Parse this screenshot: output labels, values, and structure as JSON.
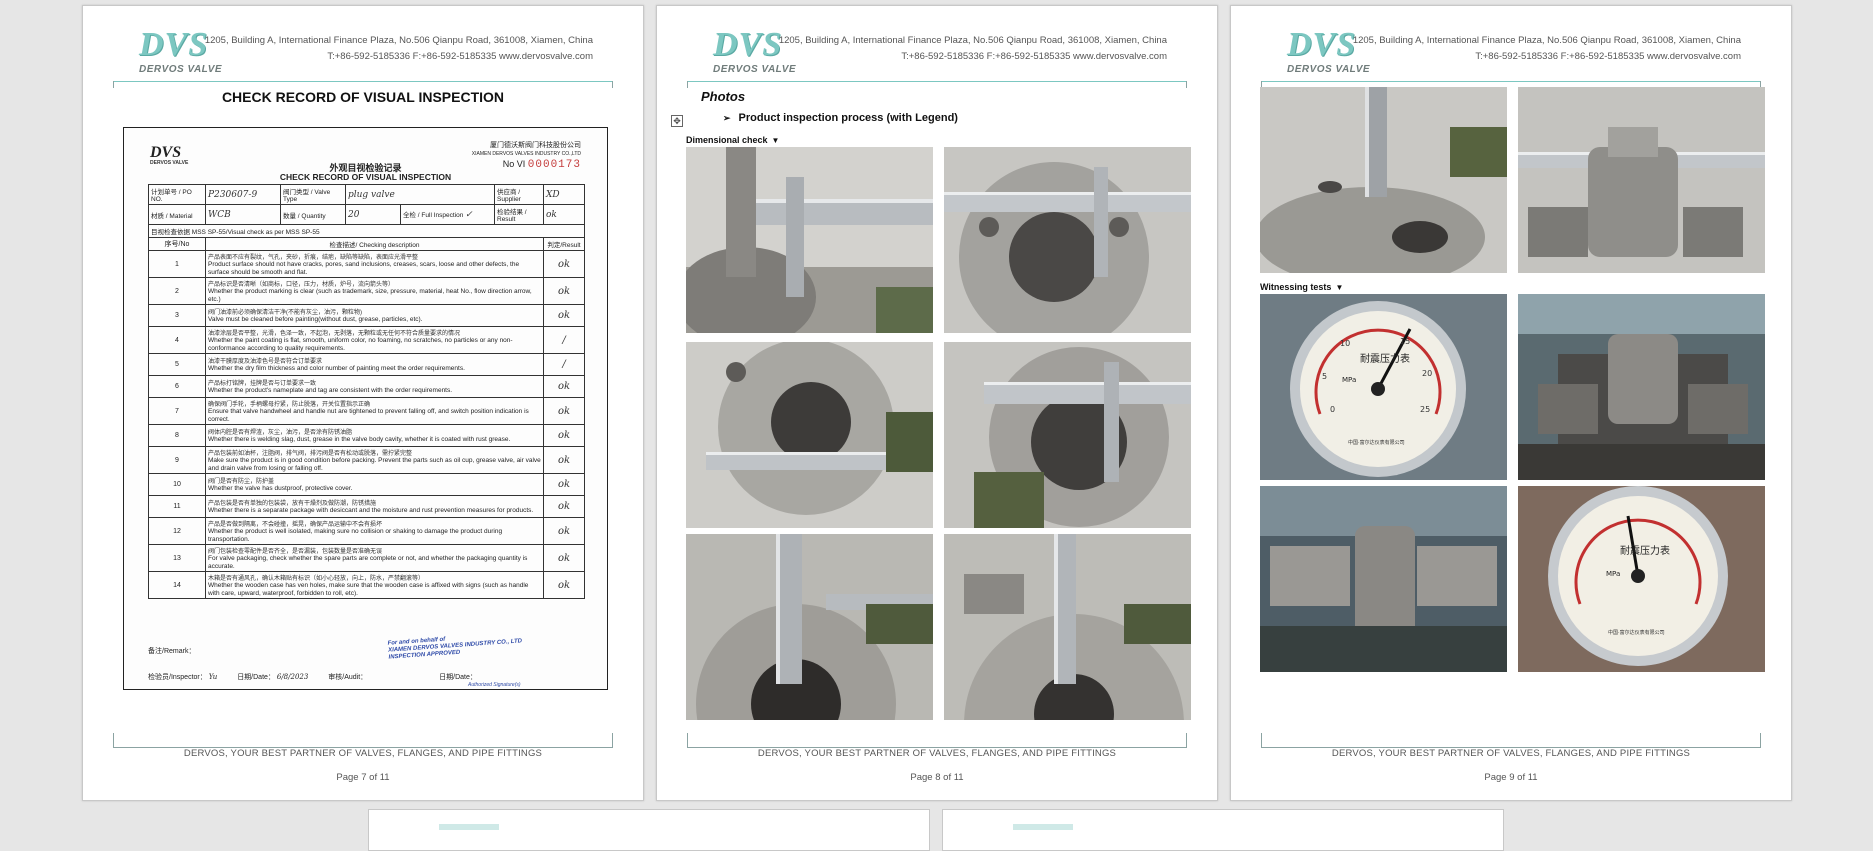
{
  "header": {
    "logo_mark": "DVS",
    "logo_sub": "DERVOS VALVE",
    "address_line1": "1205, Building A, International Finance Plaza, No.506 Qianpu Road, 361008, Xiamen, China",
    "address_line2": "T:+86-592-5185336    F:+86-592-5185335    www.dervosvalve.com"
  },
  "footer_text": "DERVOS, YOUR BEST PARTNER OF VALVES, FLANGES, AND PIPE FITTINGS",
  "pages": [
    {
      "label": "Page 7 of 11"
    },
    {
      "label": "Page 8 of 11"
    },
    {
      "label": "Page 9 of 11"
    }
  ],
  "page7": {
    "title": "CHECK RECORD OF VISUAL INSPECTION",
    "scan": {
      "logo": "DVS",
      "logo_sub": "DERVOS VALVE",
      "company_cn": "厦门德沃斯阀门科技股份公司",
      "company_en": "XIAMEN DERVOS VALVES INDUSTRY CO.,LTD",
      "no_label": "No VI",
      "no_value": "0000173",
      "title_cn": "外观目视检验记录",
      "title_en": "CHECK RECORD OF VISUAL INSPECTION",
      "po_label": "计划单号 / PO NO.",
      "po_value": "P230607-9",
      "valve_type_label": "阀门类型 / Valve Type",
      "valve_type_value": "plug valve",
      "supplier_label": "供应商 / Supplier",
      "supplier_value": "XD",
      "material_label": "材质 / Material",
      "material_value": "WCB",
      "quantity_label": "数量 / Quantity",
      "quantity_value": "20",
      "full_label": "全检 / Full Inspection",
      "full_value": "✓",
      "result_label": "检验结果 / Result",
      "result_value": "ok",
      "basis": "目视检查依据 MSS SP-55/Visual check as per  MSS SP-55",
      "col_no": "序号/No",
      "col_desc": "检查描述/ Checking description",
      "col_result": "判定/Result",
      "items": [
        {
          "no": "1",
          "cn": "产品表面不应有裂纹，气孔，夹砂，折痕，结疤，缺陷等缺陷，表面应光滑平整",
          "en": "Product surface should not have cracks, pores, sand inclusions, creases, scars, loose and other defects, the surface should be smooth and flat.",
          "result": "ok"
        },
        {
          "no": "2",
          "cn": "产品标识是否清晰（如商标，口径，压力，材质，炉号，流向箭头等）",
          "en": "Whether the product marking is clear (such as trademark, size, pressure, material, heat No., flow direction arrow, etc.)",
          "result": "ok"
        },
        {
          "no": "3",
          "cn": "阀门油漆前必须确保清洁干净(不能有灰尘，油污，颗粒物)",
          "en": "Valve must be cleaned before painting(without dust, grease, particles, etc).",
          "result": "ok"
        },
        {
          "no": "4",
          "cn": "油漆涂层是否平整，光滑，色泽一致，不起泡，无剥落，无颗粒或无任何不符合质量要求的情况",
          "en": "Whether the paint coating is flat, smooth, uniform color, no foaming, no scratches, no particles or any non-conformance according to quality requirements.",
          "result": "/"
        },
        {
          "no": "5",
          "cn": "油漆干膜厚度及油漆色号是否符合订单要求",
          "en": "Whether the dry film thickness and color number of painting meet the order requirements.",
          "result": "/"
        },
        {
          "no": "6",
          "cn": "产品标打铭牌，挂牌是否与订单要求一致",
          "en": "Whether the product's nameplate and tag are consistent with the order requirements.",
          "result": "ok"
        },
        {
          "no": "7",
          "cn": "确保阀门手轮，手柄螺母拧紧，防止脱落，开关位置指示正确",
          "en": "Ensure that valve handwheel and handle nut are tightened to prevent falling off, and switch position indication is correct.",
          "result": "ok"
        },
        {
          "no": "8",
          "cn": "阀体内腔是否有焊渣，灰尘，油污，是否涂有防锈油脂",
          "en": "Whether there is welding slag, dust, grease in the valve body cavity, whether it is coated with rust grease.",
          "result": "ok"
        },
        {
          "no": "9",
          "cn": "产品包装前如油杯，注脂阀，排气阀，排污阀是否有松动或脱落，需拧紧完整",
          "en": "Make sure the product is in good condition before packing. Prevent the parts such as oil cup, grease valve, air valve and drain valve from losing or falling off.",
          "result": "ok"
        },
        {
          "no": "10",
          "cn": "阀门是否有防尘，防护盖",
          "en": "Whether the valve has dustproof, protective cover.",
          "result": "ok"
        },
        {
          "no": "11",
          "cn": "产品包装是否有单独的包装袋，放有干燥剂及做防潮，防锈措施",
          "en": "Whether there is a separate package with desiccant and the moisture and rust prevention measures for products.",
          "result": "ok"
        },
        {
          "no": "12",
          "cn": "产品是否做到隔离，不会碰撞，摇晃，确保产品运输中不会有损坏",
          "en": "Whether the product is well isolated, making sure no collision or shaking to damage the product during transportation.",
          "result": "ok"
        },
        {
          "no": "13",
          "cn": "阀门包装检查零配件是否齐全，是否漏装，包装数量是否准确无误",
          "en": "For valve packaging, check whether the spare parts are complete or not, and whether the packaging quantity is accurate.",
          "result": "ok"
        },
        {
          "no": "14",
          "cn": "木箱是否有通风孔，确认木箱贴有标识（如小心轻放，向上，防水，严禁翻滚等）",
          "en": "Whether the wooden case has ven holes, make sure that the wooden case is affixed with signs (such as handle with care, upward, waterproof,  forbidden to roll, etc).",
          "result": "ok"
        }
      ],
      "remark_label": "备注/Remark：",
      "stamp_line1": "For and on behalf of",
      "stamp_line2": "XIAMEN DERVOS VALVES INDUSTRY CO., LTD",
      "stamp_line3": "INSPECTION  APPROVED",
      "stamp_line4": "Authorized Signature(s)",
      "inspector_label": "检验员/Inspector：",
      "inspector_value": "Yu",
      "date_label": "日期/Date：",
      "date_value": "6/8/2023",
      "audit_label": "审核/Audit：",
      "date2_label": "日期/Date："
    }
  },
  "page8": {
    "heading": "Photos",
    "bullet": "Product inspection process (with Legend)",
    "section": "Dimensional check",
    "section_marker": "▼"
  },
  "page9": {
    "section": "Witnessing tests",
    "section_marker": "▼",
    "gauge_text": "耐震压力表",
    "gauge_unit": "MPa",
    "gauge_ticks": [
      "0",
      "5",
      "10",
      "15",
      "20",
      "25"
    ],
    "gauge_maker": "中国·富尔达仪表有限公司"
  },
  "handle_glyph": "✥",
  "bullet_glyph": "➢"
}
